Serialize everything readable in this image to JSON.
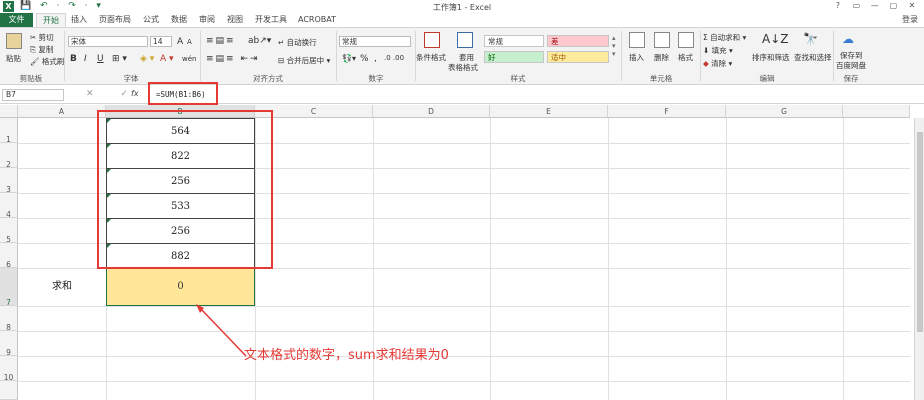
{
  "window": {
    "title": "工作簿1 - Excel",
    "logo": "X",
    "quick_access": "💾 ↶ · ↷ · ▾",
    "controls": [
      "?",
      "▭",
      "—",
      "▢",
      "✕"
    ]
  },
  "tabs": [
    "文件",
    "开始",
    "插入",
    "页面布局",
    "公式",
    "数据",
    "审阅",
    "视图",
    "开发工具",
    "ACROBAT"
  ],
  "account": "登录",
  "ribbon": {
    "clipboard": {
      "paste": "粘贴",
      "cut": "剪切",
      "copy": "复制",
      "format_painter": "格式刷",
      "label": "剪贴板"
    },
    "font": {
      "name": "宋体",
      "size": "14",
      "bold": "B",
      "italic": "I",
      "underline": "U",
      "grow": "A",
      "shrink": "A",
      "label": "字体",
      "wen": "wén"
    },
    "alignment": {
      "wrap": "自动换行",
      "merge": "合并后居中",
      "label": "对齐方式"
    },
    "number": {
      "format": "常规",
      "percent": "%",
      "comma": ",",
      "label": "数字"
    },
    "styles": {
      "conditional": "条件格式",
      "table": "套用",
      "table2": "表格格式",
      "normal": "常规",
      "bad": "差",
      "good": "好",
      "neutral": "适中",
      "label": "样式"
    },
    "cells": {
      "insert": "插入",
      "delete": "删除",
      "format": "格式",
      "label": "单元格"
    },
    "editing": {
      "autosum": "自动求和",
      "fill": "填充",
      "clear": "清除",
      "sort": "排序和筛选",
      "find": "查找和选择",
      "label": "编辑"
    },
    "save": {
      "label1": "保存到",
      "label2": "百度网盘",
      "group": "保存"
    }
  },
  "formula_bar": {
    "name_box": "B7",
    "fx": "fx",
    "buttons": "✕ ✓",
    "formula": "=SUM(B1:B6)"
  },
  "columns": [
    "A",
    "B",
    "C",
    "D",
    "E",
    "F",
    "G"
  ],
  "rows": [
    "1",
    "2",
    "3",
    "4",
    "5",
    "6",
    "7",
    "8",
    "9",
    "10"
  ],
  "cells": {
    "B1": "564",
    "B2": "822",
    "B3": "256",
    "B4": "533",
    "B5": "256",
    "B6": "882",
    "A7": "求和",
    "B7": "0"
  },
  "annotation": "文本格式的数字，sum求和结果为0",
  "colors": {
    "excel_green": "#217346",
    "highlight_red": "#e53935",
    "sum_fill": "#ffe699"
  }
}
